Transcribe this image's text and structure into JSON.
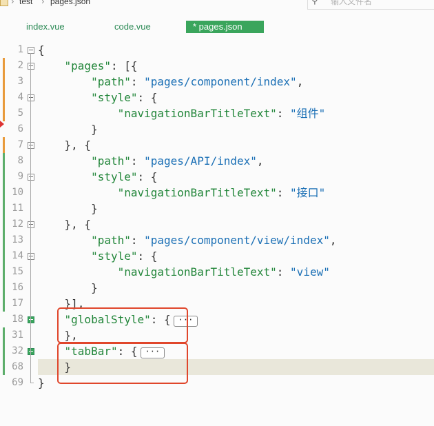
{
  "breadcrumb": {
    "project": "test",
    "file": "pages.json"
  },
  "search": {
    "placeholder": "输入文件名"
  },
  "tabs": [
    {
      "label": "index.vue",
      "active": false
    },
    {
      "label": "code.vue",
      "active": false
    },
    {
      "label": "* pages.json",
      "active": true
    }
  ],
  "editor": {
    "lines": [
      {
        "num": "1",
        "parts": [
          [
            "p",
            "{"
          ]
        ],
        "fold": "open",
        "mark": ""
      },
      {
        "num": "2",
        "parts": [
          [
            "p",
            "    "
          ],
          [
            "k",
            "\"pages\""
          ],
          [
            "p",
            ": [{"
          ]
        ],
        "fold": "open",
        "mark": "orange"
      },
      {
        "num": "3",
        "parts": [
          [
            "p",
            "        "
          ],
          [
            "k",
            "\"path\""
          ],
          [
            "p",
            ": "
          ],
          [
            "s",
            "\"pages/component/index\""
          ],
          [
            "p",
            ","
          ]
        ],
        "fold": "",
        "mark": "orange"
      },
      {
        "num": "4",
        "parts": [
          [
            "p",
            "        "
          ],
          [
            "k",
            "\"style\""
          ],
          [
            "p",
            ": {"
          ]
        ],
        "fold": "open",
        "mark": "orange"
      },
      {
        "num": "5",
        "parts": [
          [
            "p",
            "            "
          ],
          [
            "k",
            "\"navigationBarTitleText\""
          ],
          [
            "p",
            ": "
          ],
          [
            "s",
            "\"组件\""
          ]
        ],
        "fold": "",
        "mark": "orange"
      },
      {
        "num": "6",
        "parts": [
          [
            "p",
            "        }"
          ]
        ],
        "fold": "",
        "mark": ""
      },
      {
        "num": "7",
        "parts": [
          [
            "p",
            "    }, {"
          ]
        ],
        "fold": "open",
        "mark": "orange"
      },
      {
        "num": "8",
        "parts": [
          [
            "p",
            "        "
          ],
          [
            "k",
            "\"path\""
          ],
          [
            "p",
            ": "
          ],
          [
            "s",
            "\"pages/API/index\""
          ],
          [
            "p",
            ","
          ]
        ],
        "fold": "",
        "mark": "green"
      },
      {
        "num": "9",
        "parts": [
          [
            "p",
            "        "
          ],
          [
            "k",
            "\"style\""
          ],
          [
            "p",
            ": {"
          ]
        ],
        "fold": "open",
        "mark": "green"
      },
      {
        "num": "10",
        "parts": [
          [
            "p",
            "            "
          ],
          [
            "k",
            "\"navigationBarTitleText\""
          ],
          [
            "p",
            ": "
          ],
          [
            "s",
            "\"接口\""
          ]
        ],
        "fold": "",
        "mark": "green"
      },
      {
        "num": "11",
        "parts": [
          [
            "p",
            "        }"
          ]
        ],
        "fold": "",
        "mark": "green"
      },
      {
        "num": "12",
        "parts": [
          [
            "p",
            "    }, {"
          ]
        ],
        "fold": "open",
        "mark": "green"
      },
      {
        "num": "13",
        "parts": [
          [
            "p",
            "        "
          ],
          [
            "k",
            "\"path\""
          ],
          [
            "p",
            ": "
          ],
          [
            "s",
            "\"pages/component/view/index\""
          ],
          [
            "p",
            ","
          ]
        ],
        "fold": "",
        "mark": "green"
      },
      {
        "num": "14",
        "parts": [
          [
            "p",
            "        "
          ],
          [
            "k",
            "\"style\""
          ],
          [
            "p",
            ": {"
          ]
        ],
        "fold": "open",
        "mark": "green"
      },
      {
        "num": "15",
        "parts": [
          [
            "p",
            "            "
          ],
          [
            "k",
            "\"navigationBarTitleText\""
          ],
          [
            "p",
            ": "
          ],
          [
            "s",
            "\"view\""
          ]
        ],
        "fold": "",
        "mark": "green"
      },
      {
        "num": "16",
        "parts": [
          [
            "p",
            "        }"
          ]
        ],
        "fold": "",
        "mark": "green"
      },
      {
        "num": "17",
        "parts": [
          [
            "p",
            "    }],"
          ]
        ],
        "fold": "",
        "mark": "green"
      },
      {
        "num": "18",
        "parts": [
          [
            "p",
            "    "
          ],
          [
            "k",
            "\"globalStyle\""
          ],
          [
            "p",
            ": {"
          ]
        ],
        "fold": "closed",
        "mark": "",
        "ellipsis": "···"
      },
      {
        "num": "31",
        "parts": [
          [
            "p",
            "    },"
          ]
        ],
        "fold": "",
        "mark": "green"
      },
      {
        "num": "32",
        "parts": [
          [
            "p",
            "    "
          ],
          [
            "k",
            "\"tabBar\""
          ],
          [
            "p",
            ": {"
          ]
        ],
        "fold": "closed",
        "mark": "green",
        "ellipsis": "···"
      },
      {
        "num": "68",
        "parts": [
          [
            "p",
            "    }"
          ]
        ],
        "fold": "",
        "mark": "green",
        "current": true
      },
      {
        "num": "69",
        "parts": [
          [
            "p",
            "}"
          ]
        ],
        "fold": "",
        "mark": ""
      }
    ]
  }
}
